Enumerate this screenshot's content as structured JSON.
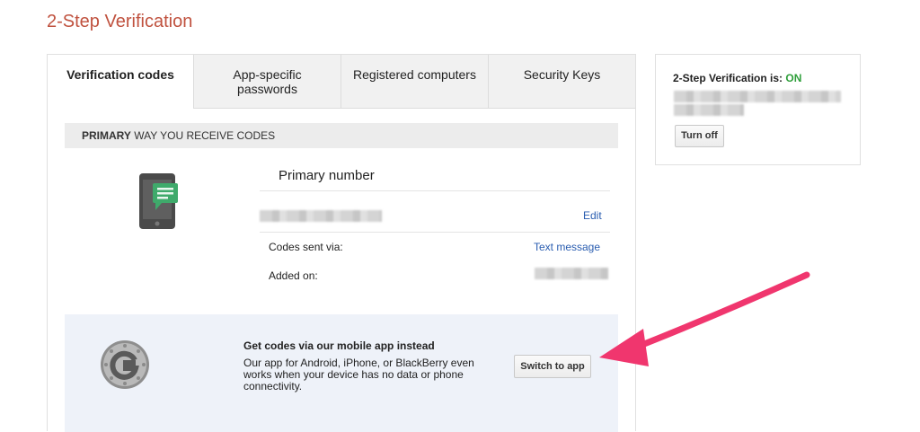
{
  "page": {
    "title": "2-Step Verification"
  },
  "tabs": [
    {
      "label": "Verification codes",
      "active": true
    },
    {
      "label": "App-specific passwords",
      "active": false
    },
    {
      "label": "Registered computers",
      "active": false
    },
    {
      "label": "Security Keys",
      "active": false
    }
  ],
  "primary_section": {
    "header_bold": "PRIMARY",
    "header_rest": " WAY YOU RECEIVE CODES",
    "primary_number_label": "Primary number",
    "edit_label": "Edit",
    "codes_sent_label": "Codes sent via:",
    "codes_sent_value": "Text message",
    "added_on_label": "Added on:"
  },
  "app_promo": {
    "title": "Get codes via our mobile app instead",
    "text": "Our app for Android, iPhone, or BlackBerry even works when your device has no data or phone connectivity.",
    "button_label": "Switch to app"
  },
  "status_box": {
    "status_label": "2-Step Verification is: ",
    "status_value": "ON",
    "turn_off_label": "Turn off"
  },
  "colors": {
    "title": "#c0523f",
    "link": "#2a5db0",
    "status_on": "#2e9e3a",
    "arrow": "#f0366e",
    "phone_bubble": "#3faa6b"
  },
  "icons": [
    "phone-sms-icon",
    "google-authenticator-icon",
    "annotation-arrow"
  ]
}
